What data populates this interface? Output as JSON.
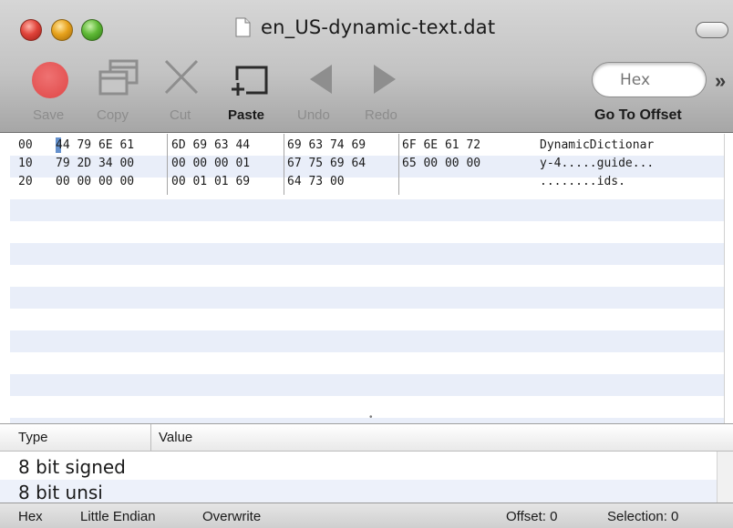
{
  "window": {
    "title": "en_US-dynamic-text.dat"
  },
  "toolbar": {
    "items": [
      {
        "id": "save",
        "label": "Save",
        "icon": "record-circle-icon",
        "enabled": false
      },
      {
        "id": "copy",
        "label": "Copy",
        "icon": "copy-windows-icon",
        "enabled": false
      },
      {
        "id": "cut",
        "label": "Cut",
        "icon": "scissors-icon",
        "enabled": false
      },
      {
        "id": "paste",
        "label": "Paste",
        "icon": "paste-icon",
        "enabled": true
      },
      {
        "id": "undo",
        "label": "Undo",
        "icon": "arrow-left-icon",
        "enabled": false
      },
      {
        "id": "redo",
        "label": "Redo",
        "icon": "arrow-right-icon",
        "enabled": false
      }
    ],
    "goto": {
      "placeholder": "Hex",
      "label": "Go To Offset"
    },
    "overflow": "»"
  },
  "hex": {
    "rows": [
      {
        "offset": "00",
        "groups": [
          "44 79 6E 61",
          "6D 69 63 44",
          "69 63 74 69",
          "6F 6E 61 72"
        ],
        "ascii": "DynamicDictionar"
      },
      {
        "offset": "10",
        "groups": [
          "79 2D 34 00",
          "00 00 00 01",
          "67 75 69 64",
          "65 00 00 00"
        ],
        "ascii": "y-4.....guide..."
      },
      {
        "offset": "20",
        "groups": [
          "00 00 00 00",
          "00 01 01 69",
          "64 73 00",
          ""
        ],
        "ascii": "........ids."
      }
    ]
  },
  "inspector": {
    "columns": [
      "Type",
      "Value"
    ],
    "rows": [
      {
        "type": "8 bit signed",
        "value": ""
      },
      {
        "type": "8 bit unsi",
        "value": ""
      }
    ]
  },
  "status": {
    "mode": "Hex",
    "endian": "Little Endian",
    "insert": "Overwrite",
    "offset": "Offset: 0",
    "selection": "Selection: 0"
  },
  "colors": {
    "close": "#e0443a",
    "minimize": "#e7a21c",
    "zoom": "#5fb936",
    "save_icon": "#e85a5a",
    "row_stripe": "#e9eef9",
    "caret": "#4a7ec4"
  }
}
